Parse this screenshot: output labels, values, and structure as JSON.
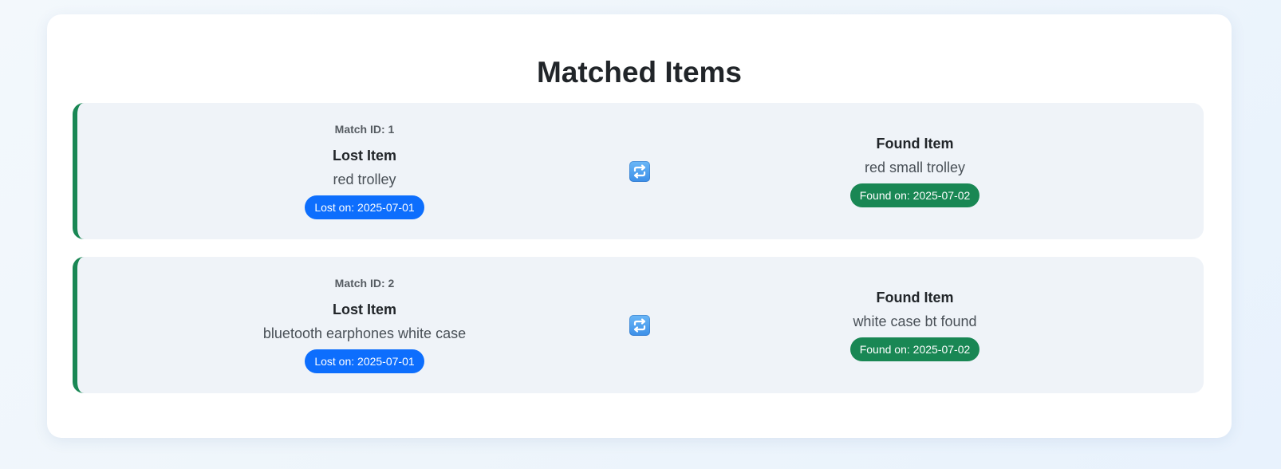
{
  "page": {
    "title": "Matched Items"
  },
  "matches": [
    {
      "match_id_label": "Match ID: 1",
      "lost": {
        "heading": "Lost Item",
        "description": "red trolley",
        "date_label": "Lost on: 2025-07-01"
      },
      "swap_icon": "repeat-arrows-icon",
      "found": {
        "heading": "Found Item",
        "description": "red small trolley",
        "date_label": "Found on: 2025-07-02"
      }
    },
    {
      "match_id_label": "Match ID: 2",
      "lost": {
        "heading": "Lost Item",
        "description": "bluetooth earphones white case",
        "date_label": "Lost on: 2025-07-01"
      },
      "swap_icon": "repeat-arrows-icon",
      "found": {
        "heading": "Found Item",
        "description": "white case bt found",
        "date_label": "Found on: 2025-07-02"
      }
    }
  ],
  "colors": {
    "accent_border": "#198754",
    "lost_badge": "#0d6efd",
    "found_badge": "#198754",
    "card_background": "#eff3f8"
  }
}
